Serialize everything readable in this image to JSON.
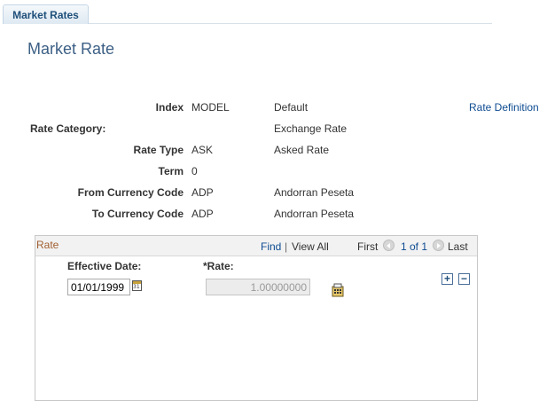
{
  "tabs": [
    {
      "label": "Market Rates"
    }
  ],
  "page_title": "Market Rate",
  "rate_definition_link": "Rate Definition",
  "fields": {
    "index": {
      "label": "Index",
      "value": "MODEL",
      "description": "Default"
    },
    "rate_category": {
      "label": "Rate Category:",
      "description": "Exchange Rate"
    },
    "rate_type": {
      "label": "Rate Type",
      "value": "ASK",
      "description": "Asked Rate"
    },
    "term": {
      "label": "Term",
      "value": "0"
    },
    "from_currency": {
      "label": "From Currency Code",
      "value": "ADP",
      "description": "Andorran Peseta"
    },
    "to_currency": {
      "label": "To Currency Code",
      "value": "ADP",
      "description": "Andorran Peseta"
    }
  },
  "rate_grid": {
    "title": "Rate",
    "find_label": "Find",
    "separator": "|",
    "view_all_label": "View All",
    "first_label": "First",
    "pager_text": "1 of 1",
    "last_label": "Last",
    "effective_date_label": "Effective Date:",
    "effective_date_value": "01/01/1999",
    "rate_label": "*Rate:",
    "rate_value": "1.00000000",
    "add_row_label": "+",
    "delete_row_label": "−"
  },
  "icons": {
    "calendar": "calendar-icon",
    "calculator": "calculator-icon",
    "nav_prev": "chevron-left-icon",
    "nav_next": "chevron-right-icon"
  },
  "colors": {
    "tab_text": "#1f4f7a",
    "page_title": "#3c5f85",
    "link": "#0e4c92",
    "grid_title": "#a06030"
  }
}
